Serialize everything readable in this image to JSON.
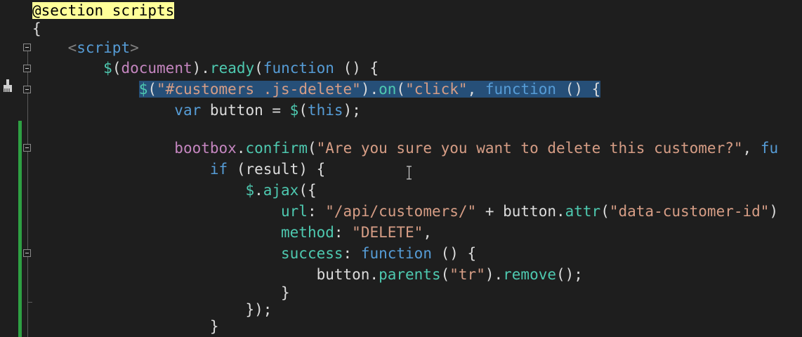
{
  "editor": {
    "lines": [
      {
        "tokens": [
          {
            "t": "@section scripts",
            "c": "razor"
          }
        ]
      },
      {
        "tokens": [
          {
            "t": "{",
            "c": "pn"
          }
        ]
      },
      {
        "tokens": [
          {
            "t": "    ",
            "c": "pn"
          },
          {
            "t": "<",
            "c": "tagb"
          },
          {
            "t": "script",
            "c": "tag"
          },
          {
            "t": ">",
            "c": "tagb"
          }
        ]
      },
      {
        "tokens": [
          {
            "t": "        ",
            "c": "pn"
          },
          {
            "t": "$",
            "c": "fn"
          },
          {
            "t": "(",
            "c": "pn"
          },
          {
            "t": "document",
            "c": "obj"
          },
          {
            "t": ").",
            "c": "pn"
          },
          {
            "t": "ready",
            "c": "fn"
          },
          {
            "t": "(",
            "c": "pn"
          },
          {
            "t": "function",
            "c": "kw"
          },
          {
            "t": " () {",
            "c": "pn"
          }
        ]
      },
      {
        "tokens": [
          {
            "t": "            ",
            "c": "pn"
          },
          {
            "t": "$",
            "c": "fn",
            "s": 1
          },
          {
            "t": "(",
            "c": "pn",
            "s": 1
          },
          {
            "t": "\"#customers .js-delete\"",
            "c": "str",
            "s": 1
          },
          {
            "t": ").",
            "c": "pn",
            "s": 1
          },
          {
            "t": "on",
            "c": "fn",
            "s": 1
          },
          {
            "t": "(",
            "c": "pn",
            "s": 1
          },
          {
            "t": "\"click\"",
            "c": "str",
            "s": 1
          },
          {
            "t": ", ",
            "c": "pn",
            "s": 1
          },
          {
            "t": "function",
            "c": "kw",
            "s": 1
          },
          {
            "t": " () {",
            "c": "pn",
            "s": 1
          }
        ]
      },
      {
        "tokens": [
          {
            "t": "                ",
            "c": "pn"
          },
          {
            "t": "var",
            "c": "kw"
          },
          {
            "t": " button = ",
            "c": "pn"
          },
          {
            "t": "$",
            "c": "fn"
          },
          {
            "t": "(",
            "c": "pn"
          },
          {
            "t": "this",
            "c": "kw"
          },
          {
            "t": ");",
            "c": "pn"
          }
        ]
      },
      {
        "tokens": []
      },
      {
        "tokens": [
          {
            "t": "                ",
            "c": "pn"
          },
          {
            "t": "bootbox",
            "c": "obj"
          },
          {
            "t": ".",
            "c": "pn"
          },
          {
            "t": "confirm",
            "c": "fn"
          },
          {
            "t": "(",
            "c": "pn"
          },
          {
            "t": "\"Are you sure you want to delete this customer?\"",
            "c": "str"
          },
          {
            "t": ", ",
            "c": "pn"
          },
          {
            "t": "fu",
            "c": "kw"
          }
        ]
      },
      {
        "tokens": [
          {
            "t": "                    ",
            "c": "pn"
          },
          {
            "t": "if",
            "c": "kw"
          },
          {
            "t": " (result) {",
            "c": "pn"
          }
        ]
      },
      {
        "tokens": [
          {
            "t": "                        ",
            "c": "pn"
          },
          {
            "t": "$",
            "c": "fn"
          },
          {
            "t": ".",
            "c": "pn"
          },
          {
            "t": "ajax",
            "c": "fn"
          },
          {
            "t": "({",
            "c": "pn"
          }
        ]
      },
      {
        "tokens": [
          {
            "t": "                            ",
            "c": "pn"
          },
          {
            "t": "url",
            "c": "prop"
          },
          {
            "t": ": ",
            "c": "pn"
          },
          {
            "t": "\"/api/customers/\"",
            "c": "str"
          },
          {
            "t": " + button.",
            "c": "pn"
          },
          {
            "t": "attr",
            "c": "fn"
          },
          {
            "t": "(",
            "c": "pn"
          },
          {
            "t": "\"data-customer-id\"",
            "c": "str"
          },
          {
            "t": ")",
            "c": "pn"
          }
        ]
      },
      {
        "tokens": [
          {
            "t": "                            ",
            "c": "pn"
          },
          {
            "t": "method",
            "c": "prop"
          },
          {
            "t": ": ",
            "c": "pn"
          },
          {
            "t": "\"DELETE\"",
            "c": "str"
          },
          {
            "t": ",",
            "c": "pn"
          }
        ]
      },
      {
        "tokens": [
          {
            "t": "                            ",
            "c": "pn"
          },
          {
            "t": "success",
            "c": "prop"
          },
          {
            "t": ": ",
            "c": "pn"
          },
          {
            "t": "function",
            "c": "kw"
          },
          {
            "t": " () {",
            "c": "pn"
          }
        ]
      },
      {
        "tokens": [
          {
            "t": "                                ",
            "c": "pn"
          },
          {
            "t": "button.",
            "c": "pn"
          },
          {
            "t": "parents",
            "c": "fn"
          },
          {
            "t": "(",
            "c": "pn"
          },
          {
            "t": "\"tr\"",
            "c": "str"
          },
          {
            "t": ").",
            "c": "pn"
          },
          {
            "t": "remove",
            "c": "fn"
          },
          {
            "t": "();",
            "c": "pn"
          }
        ]
      },
      {
        "tokens": [
          {
            "t": "                            ",
            "c": "pn"
          },
          {
            "t": "}",
            "c": "pn"
          }
        ]
      },
      {
        "tokens": [
          {
            "t": "                        ",
            "c": "pn"
          },
          {
            "t": "});",
            "c": "pn"
          }
        ]
      },
      {
        "tokens": [
          {
            "t": "                    ",
            "c": "pn"
          },
          {
            "t": "}",
            "c": "pn"
          }
        ]
      }
    ]
  },
  "colors": {
    "background": "#1e1e1e",
    "selection": "#264f78",
    "change_bar": "#2ea043",
    "keyword": "#569cd6",
    "string": "#d69d85",
    "function": "#4ec9b0",
    "object": "#c586c0",
    "razor_highlight": "#ffff99"
  },
  "icons": [
    "fold-collapse-icon",
    "brush-icon",
    "text-cursor-icon"
  ]
}
